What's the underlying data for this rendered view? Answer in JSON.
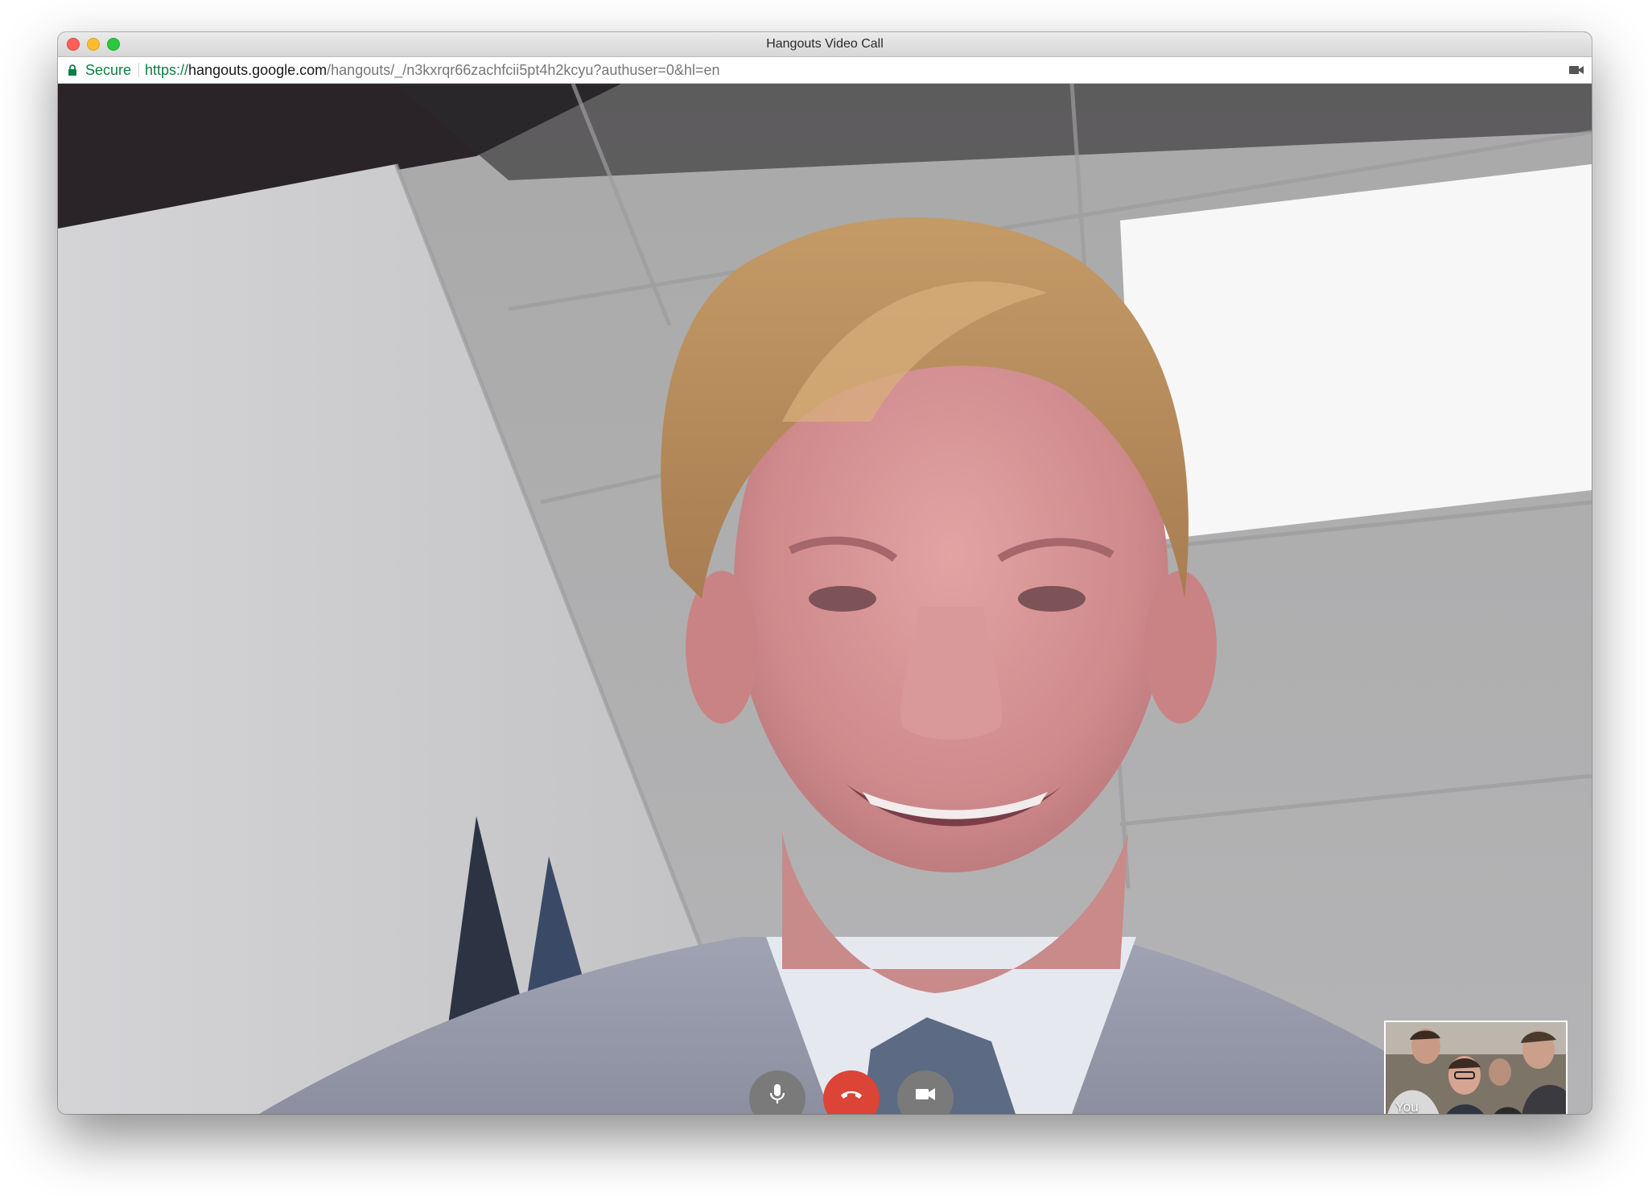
{
  "window": {
    "title": "Hangouts Video Call"
  },
  "address_bar": {
    "secure_label": "Secure",
    "url_scheme": "https://",
    "url_host": "hangouts.google.com",
    "url_path": "/hangouts/_/n3kxrqr66zachfcii5pt4h2kcyu?authuser=0&hl=en",
    "camera_indicator_icon": "video-camera-icon"
  },
  "call": {
    "self_view_label": "You"
  },
  "controls": {
    "mic_icon": "microphone-icon",
    "hangup_icon": "hang-up-icon",
    "video_icon": "video-camera-icon"
  },
  "colors": {
    "secure_green": "#0b8043",
    "hangup_red": "#db4437",
    "control_gray": "#7a7a7a"
  }
}
